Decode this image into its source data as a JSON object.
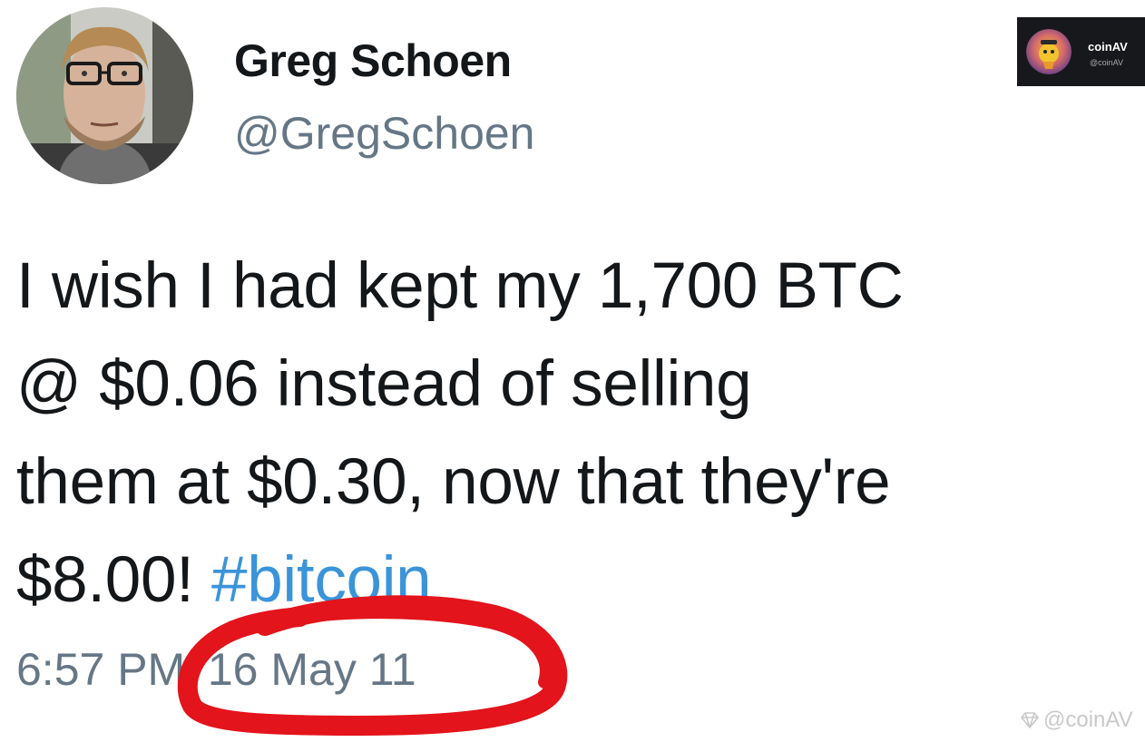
{
  "tweet": {
    "author": {
      "display_name": "Greg Schoen",
      "handle": "@GregSchoen"
    },
    "text": {
      "line1": "I wish I had kept my 1,700 BTC",
      "line2": "@ $0.06 instead of selling",
      "line3": "them at $0.30, now that they're",
      "line4_prefix": "$8.00!",
      "hashtag": "#bitcoin"
    },
    "timestamp": {
      "time": "6:57 PM",
      "separator": "·",
      "date": "16 May 11"
    }
  },
  "overlay": {
    "badge_title": "coinAV",
    "badge_handle": "@coinAV",
    "watermark": "@coinAV",
    "highlight_color": "#e3141b"
  },
  "colors": {
    "text": "#14171a",
    "secondary": "#657786",
    "hashtag": "#3b94d9"
  }
}
